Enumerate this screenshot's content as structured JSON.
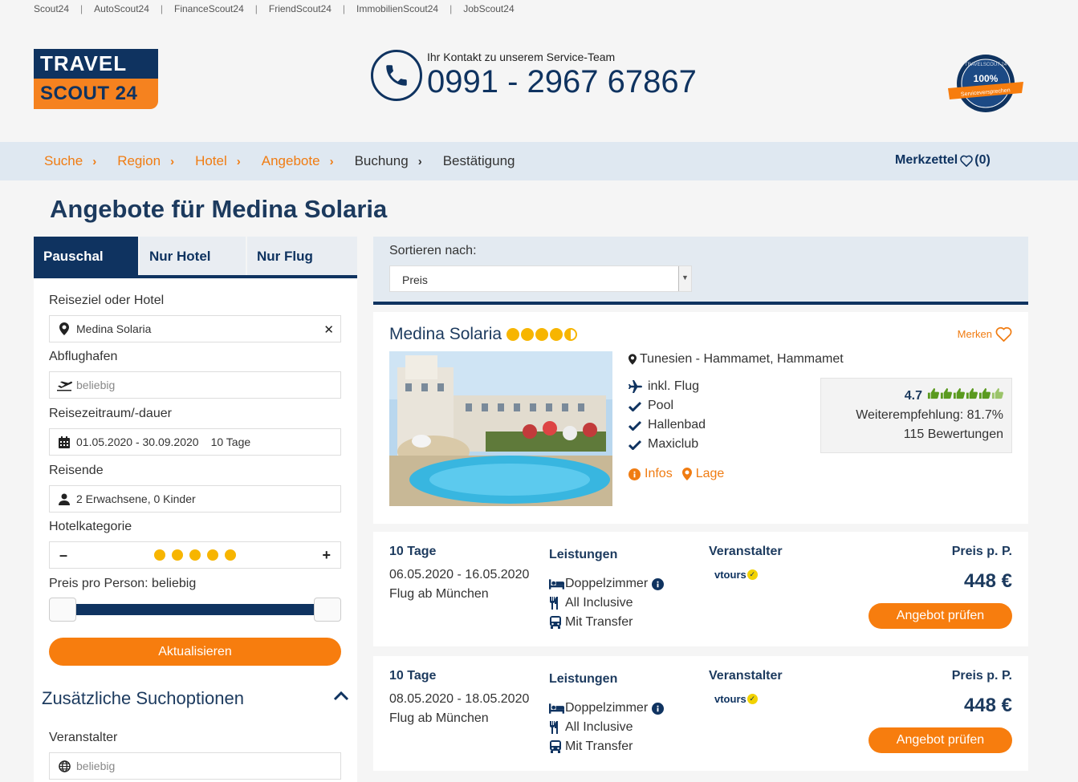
{
  "top_links": [
    "Scout24",
    "AutoScout24",
    "FinanceScout24",
    "FriendScout24",
    "ImmobilienScout24",
    "JobScout24"
  ],
  "logo": {
    "line1": "TRAVEL",
    "line2": "SCOUT 24"
  },
  "contact": {
    "caption": "Ihr Kontakt zu unserem Service-Team",
    "phone": "0991 - 2967 67867"
  },
  "seal": {
    "brand": "TRAVELSCOUT 24",
    "percent": "100%",
    "ribbon": "Serviceversprechen"
  },
  "breadcrumb": [
    {
      "label": "Suche"
    },
    {
      "label": "Region"
    },
    {
      "label": "Hotel"
    },
    {
      "label": "Angebote"
    },
    {
      "label": "Buchung"
    },
    {
      "label": "Bestätigung"
    }
  ],
  "merkzettel": {
    "label": "Merkzettel",
    "count": "(0)"
  },
  "page_title": "Angebote für Medina Solaria",
  "search": {
    "tabs": [
      "Pauschal",
      "Nur Hotel",
      "Nur Flug"
    ],
    "destination_label": "Reiseziel oder Hotel",
    "destination_value": "Medina Solaria",
    "airport_label": "Abflughafen",
    "airport_placeholder": "beliebig",
    "period_label": "Reisezeitraum/-dauer",
    "period_value": "01.05.2020 - 30.09.2020",
    "duration_value": "10 Tage",
    "travellers_label": "Reisende",
    "travellers_value": "2 Erwachsene, 0 Kinder",
    "category_label": "Hotelkategorie",
    "category_stars": 5,
    "price_label": "Preis pro Person: beliebig",
    "update_button": "Aktualisieren",
    "extra_options": "Zusätzliche Suchoptionen",
    "operator_label": "Veranstalter",
    "operator_placeholder": "beliebig"
  },
  "sort": {
    "label": "Sortieren nach:",
    "value": "Preis"
  },
  "hotel": {
    "name": "Medina Solaria",
    "stars": 4.5,
    "merken": "Merken",
    "location": "Tunesien - Hammamet, Hammamet",
    "features": [
      "inkl. Flug",
      "Pool",
      "Hallenbad",
      "Maxiclub"
    ],
    "infos": "Infos",
    "lage": "Lage",
    "rating_score": "4.7",
    "recommendation": "Weiterempfehlung: 81.7%",
    "reviews": "115 Bewertungen"
  },
  "offers": [
    {
      "duration": "10 Tage",
      "dates": "06.05.2020 - 16.05.2020",
      "flight": "Flug ab München",
      "services_head": "Leistungen",
      "room": "Doppelzimmer",
      "board": "All Inclusive",
      "transfer": "Mit Transfer",
      "operator_head": "Veranstalter",
      "operator": "vtours",
      "price_head": "Preis p. P.",
      "price": "448 €",
      "button": "Angebot prüfen"
    },
    {
      "duration": "10 Tage",
      "dates": "08.05.2020 - 18.05.2020",
      "flight": "Flug ab München",
      "services_head": "Leistungen",
      "room": "Doppelzimmer",
      "board": "All Inclusive",
      "transfer": "Mit Transfer",
      "operator_head": "Veranstalter",
      "operator": "vtours",
      "price_head": "Preis p. P.",
      "price": "448 €",
      "button": "Angebot prüfen"
    }
  ],
  "colors": {
    "navy": "#0f3360",
    "orange": "#f77d0e",
    "star": "#f7b500",
    "crumb_bg": "#dfe8f1"
  }
}
